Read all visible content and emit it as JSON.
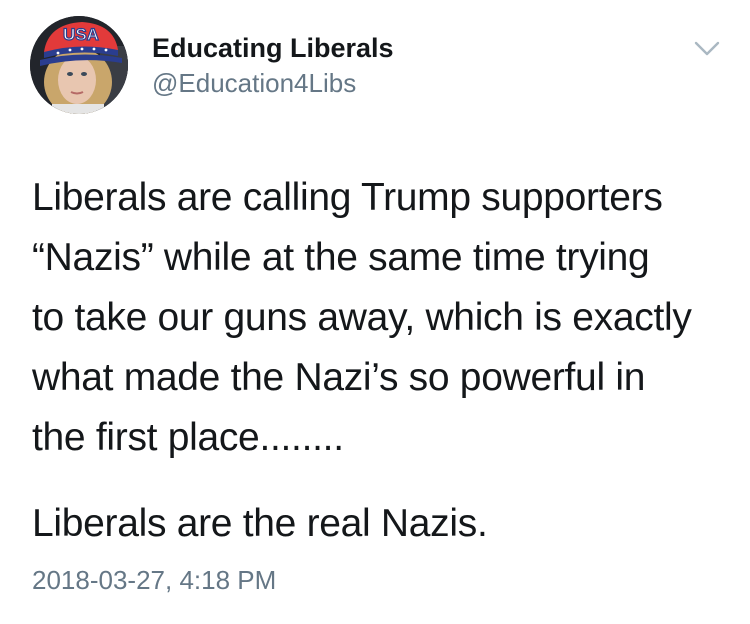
{
  "tweet": {
    "author": {
      "display_name": "Educating Liberals",
      "handle": "@Education4Libs",
      "avatar_icon": "profile-photo",
      "hat_text": "USA"
    },
    "menu_icon": "chevron-down-icon",
    "body_lines": [
      "Liberals are calling Trump supporters",
      "“Nazis” while at the same time trying",
      "to take our guns away, which is exactly",
      "what made the Nazi’s so powerful in",
      "the first place........"
    ],
    "body_paragraph_2": "Liberals are the real Nazis.",
    "timestamp": "2018-03-27, 4:18 PM",
    "colors": {
      "text": "#14171a",
      "secondary": "#657786",
      "background": "#ffffff"
    }
  }
}
